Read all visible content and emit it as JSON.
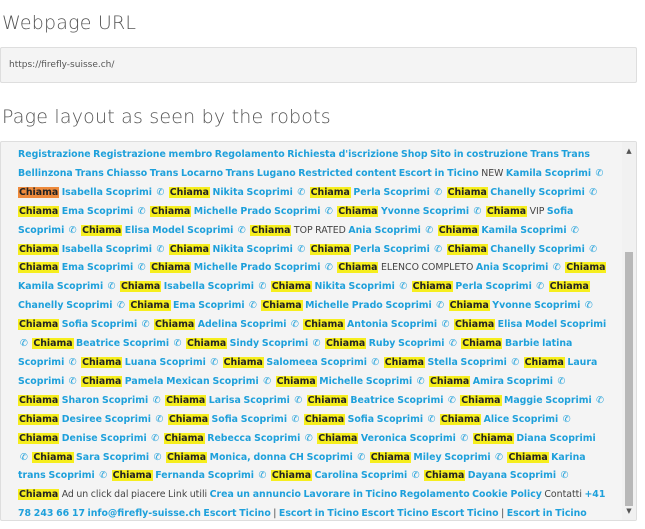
{
  "headings": {
    "url": "Webpage URL",
    "layout": "Page layout as seen by the robots"
  },
  "url_value": "https://firefly-suisse.ch/",
  "icons": {
    "phone": "phone-icon",
    "scroll_up": "scroll-up-arrow-icon",
    "scroll_down": "scroll-down-arrow-icon"
  },
  "colors": {
    "link": "#1ea0db",
    "highlight": "#f6ee1e",
    "highlight_current": "#ee8a3c"
  },
  "tokens": [
    {
      "t": "link",
      "v": "Registrazione"
    },
    {
      "t": "link",
      "v": "Registrazione membro"
    },
    {
      "t": "link",
      "v": "Regolamento"
    },
    {
      "t": "link",
      "v": "Richiesta d'iscrizione"
    },
    {
      "t": "link",
      "v": "Shop"
    },
    {
      "t": "link",
      "v": "Sito in costruzione"
    },
    {
      "t": "link",
      "v": "Trans"
    },
    {
      "t": "link",
      "v": "Trans Bellinzona"
    },
    {
      "t": "link",
      "v": "Trans Chiasso"
    },
    {
      "t": "link",
      "v": "Trans Locarno"
    },
    {
      "t": "link",
      "v": "Trans Lugano"
    },
    {
      "t": "link",
      "v": "Restricted content"
    },
    {
      "t": "link",
      "v": "Escort in Ticino"
    },
    {
      "t": "plain",
      "v": "NEW"
    },
    {
      "t": "link",
      "v": "Kamila Scoprimi"
    },
    {
      "t": "phone"
    },
    {
      "t": "mark",
      "v": "Chiama",
      "cur": true
    },
    {
      "t": "link",
      "v": "Isabella Scoprimi"
    },
    {
      "t": "phone"
    },
    {
      "t": "mark",
      "v": "Chiama"
    },
    {
      "t": "link",
      "v": "Nikita Scoprimi"
    },
    {
      "t": "phone"
    },
    {
      "t": "mark",
      "v": "Chiama"
    },
    {
      "t": "link",
      "v": "Perla Scoprimi"
    },
    {
      "t": "phone"
    },
    {
      "t": "mark",
      "v": "Chiama"
    },
    {
      "t": "link",
      "v": "Chanelly Scoprimi"
    },
    {
      "t": "phone"
    },
    {
      "t": "mark",
      "v": "Chiama"
    },
    {
      "t": "link",
      "v": "Ema Scoprimi"
    },
    {
      "t": "phone"
    },
    {
      "t": "mark",
      "v": "Chiama"
    },
    {
      "t": "link",
      "v": "Michelle Prado Scoprimi"
    },
    {
      "t": "phone"
    },
    {
      "t": "mark",
      "v": "Chiama"
    },
    {
      "t": "link",
      "v": "Yvonne Scoprimi"
    },
    {
      "t": "phone"
    },
    {
      "t": "mark",
      "v": "Chiama"
    },
    {
      "t": "plain",
      "v": "VIP"
    },
    {
      "t": "link",
      "v": "Sofia Scoprimi"
    },
    {
      "t": "phone"
    },
    {
      "t": "mark",
      "v": "Chiama"
    },
    {
      "t": "link",
      "v": "Elisa Model Scoprimi"
    },
    {
      "t": "phone"
    },
    {
      "t": "mark",
      "v": "Chiama"
    },
    {
      "t": "plain",
      "v": "TOP RATED"
    },
    {
      "t": "link",
      "v": "Ania Scoprimi"
    },
    {
      "t": "phone"
    },
    {
      "t": "mark",
      "v": "Chiama"
    },
    {
      "t": "link",
      "v": "Kamila Scoprimi"
    },
    {
      "t": "phone"
    },
    {
      "t": "mark",
      "v": "Chiama"
    },
    {
      "t": "link",
      "v": "Isabella Scoprimi"
    },
    {
      "t": "phone"
    },
    {
      "t": "mark",
      "v": "Chiama"
    },
    {
      "t": "link",
      "v": "Nikita Scoprimi"
    },
    {
      "t": "phone"
    },
    {
      "t": "mark",
      "v": "Chiama"
    },
    {
      "t": "link",
      "v": "Perla Scoprimi"
    },
    {
      "t": "phone"
    },
    {
      "t": "mark",
      "v": "Chiama"
    },
    {
      "t": "link",
      "v": "Chanelly Scoprimi"
    },
    {
      "t": "phone"
    },
    {
      "t": "mark",
      "v": "Chiama"
    },
    {
      "t": "link",
      "v": "Ema Scoprimi"
    },
    {
      "t": "phone"
    },
    {
      "t": "mark",
      "v": "Chiama"
    },
    {
      "t": "link",
      "v": "Michelle Prado Scoprimi"
    },
    {
      "t": "phone"
    },
    {
      "t": "mark",
      "v": "Chiama"
    },
    {
      "t": "plain",
      "v": "ELENCO COMPLETO"
    },
    {
      "t": "link",
      "v": "Ania Scoprimi"
    },
    {
      "t": "phone"
    },
    {
      "t": "mark",
      "v": "Chiama"
    },
    {
      "t": "link",
      "v": "Kamila Scoprimi"
    },
    {
      "t": "phone"
    },
    {
      "t": "mark",
      "v": "Chiama"
    },
    {
      "t": "link",
      "v": "Isabella Scoprimi"
    },
    {
      "t": "phone"
    },
    {
      "t": "mark",
      "v": "Chiama"
    },
    {
      "t": "link",
      "v": "Nikita Scoprimi"
    },
    {
      "t": "phone"
    },
    {
      "t": "mark",
      "v": "Chiama"
    },
    {
      "t": "link",
      "v": "Perla Scoprimi"
    },
    {
      "t": "phone"
    },
    {
      "t": "mark",
      "v": "Chiama"
    },
    {
      "t": "link",
      "v": "Chanelly Scoprimi"
    },
    {
      "t": "phone"
    },
    {
      "t": "mark",
      "v": "Chiama"
    },
    {
      "t": "link",
      "v": "Ema Scoprimi"
    },
    {
      "t": "phone"
    },
    {
      "t": "mark",
      "v": "Chiama"
    },
    {
      "t": "link",
      "v": "Michelle Prado Scoprimi"
    },
    {
      "t": "phone"
    },
    {
      "t": "mark",
      "v": "Chiama"
    },
    {
      "t": "link",
      "v": "Yvonne Scoprimi"
    },
    {
      "t": "phone"
    },
    {
      "t": "mark",
      "v": "Chiama"
    },
    {
      "t": "link",
      "v": "Sofia Scoprimi"
    },
    {
      "t": "phone"
    },
    {
      "t": "mark",
      "v": "Chiama"
    },
    {
      "t": "link",
      "v": "Adelina Scoprimi"
    },
    {
      "t": "phone"
    },
    {
      "t": "mark",
      "v": "Chiama"
    },
    {
      "t": "link",
      "v": "Antonia Scoprimi"
    },
    {
      "t": "phone"
    },
    {
      "t": "mark",
      "v": "Chiama"
    },
    {
      "t": "link",
      "v": "Elisa Model Scoprimi"
    },
    {
      "t": "phone"
    },
    {
      "t": "mark",
      "v": "Chiama"
    },
    {
      "t": "link",
      "v": "Beatrice Scoprimi"
    },
    {
      "t": "phone"
    },
    {
      "t": "mark",
      "v": "Chiama"
    },
    {
      "t": "link",
      "v": "Sindy Scoprimi"
    },
    {
      "t": "phone"
    },
    {
      "t": "mark",
      "v": "Chiama"
    },
    {
      "t": "link",
      "v": "Ruby Scoprimi"
    },
    {
      "t": "phone"
    },
    {
      "t": "mark",
      "v": "Chiama"
    },
    {
      "t": "link",
      "v": "Barbie latina Scoprimi"
    },
    {
      "t": "phone"
    },
    {
      "t": "mark",
      "v": "Chiama"
    },
    {
      "t": "link",
      "v": "Luana Scoprimi"
    },
    {
      "t": "phone"
    },
    {
      "t": "mark",
      "v": "Chiama"
    },
    {
      "t": "link",
      "v": "Salomeea Scoprimi"
    },
    {
      "t": "phone"
    },
    {
      "t": "mark",
      "v": "Chiama"
    },
    {
      "t": "link",
      "v": "Stella Scoprimi"
    },
    {
      "t": "phone"
    },
    {
      "t": "mark",
      "v": "Chiama"
    },
    {
      "t": "link",
      "v": "Laura Scoprimi"
    },
    {
      "t": "phone"
    },
    {
      "t": "mark",
      "v": "Chiama"
    },
    {
      "t": "link",
      "v": "Pamela Mexican Scoprimi"
    },
    {
      "t": "phone"
    },
    {
      "t": "mark",
      "v": "Chiama"
    },
    {
      "t": "link",
      "v": "Michelle Scoprimi"
    },
    {
      "t": "phone"
    },
    {
      "t": "mark",
      "v": "Chiama"
    },
    {
      "t": "link",
      "v": "Amira Scoprimi"
    },
    {
      "t": "phone"
    },
    {
      "t": "mark",
      "v": "Chiama"
    },
    {
      "t": "link",
      "v": "Sharon Scoprimi"
    },
    {
      "t": "phone"
    },
    {
      "t": "mark",
      "v": "Chiama"
    },
    {
      "t": "link",
      "v": "Larisa Scoprimi"
    },
    {
      "t": "phone"
    },
    {
      "t": "mark",
      "v": "Chiama"
    },
    {
      "t": "link",
      "v": "Beatrice Scoprimi"
    },
    {
      "t": "phone"
    },
    {
      "t": "mark",
      "v": "Chiama"
    },
    {
      "t": "link",
      "v": "Maggie Scoprimi"
    },
    {
      "t": "phone"
    },
    {
      "t": "mark",
      "v": "Chiama"
    },
    {
      "t": "link",
      "v": "Desiree Scoprimi"
    },
    {
      "t": "phone"
    },
    {
      "t": "mark",
      "v": "Chiama"
    },
    {
      "t": "link",
      "v": "Sofia Scoprimi"
    },
    {
      "t": "phone"
    },
    {
      "t": "mark",
      "v": "Chiama"
    },
    {
      "t": "link",
      "v": "Sofia Scoprimi"
    },
    {
      "t": "phone"
    },
    {
      "t": "mark",
      "v": "Chiama"
    },
    {
      "t": "link",
      "v": "Alice Scoprimi"
    },
    {
      "t": "phone"
    },
    {
      "t": "mark",
      "v": "Chiama"
    },
    {
      "t": "link",
      "v": "Denise Scoprimi"
    },
    {
      "t": "phone"
    },
    {
      "t": "mark",
      "v": "Chiama"
    },
    {
      "t": "link",
      "v": "Rebecca Scoprimi"
    },
    {
      "t": "phone"
    },
    {
      "t": "mark",
      "v": "Chiama"
    },
    {
      "t": "link",
      "v": "Veronica Scoprimi"
    },
    {
      "t": "phone"
    },
    {
      "t": "mark",
      "v": "Chiama"
    },
    {
      "t": "link",
      "v": "Diana Scoprimi"
    },
    {
      "t": "phone"
    },
    {
      "t": "mark",
      "v": "Chiama"
    },
    {
      "t": "link",
      "v": "Sara Scoprimi"
    },
    {
      "t": "phone"
    },
    {
      "t": "mark",
      "v": "Chiama"
    },
    {
      "t": "link",
      "v": "Monica, donna CH Scoprimi"
    },
    {
      "t": "phone"
    },
    {
      "t": "mark",
      "v": "Chiama"
    },
    {
      "t": "link",
      "v": "Miley Scoprimi"
    },
    {
      "t": "phone"
    },
    {
      "t": "mark",
      "v": "Chiama"
    },
    {
      "t": "link",
      "v": "Karina trans Scoprimi"
    },
    {
      "t": "phone"
    },
    {
      "t": "mark",
      "v": "Chiama"
    },
    {
      "t": "link",
      "v": "Fernanda Scoprimi"
    },
    {
      "t": "phone"
    },
    {
      "t": "mark",
      "v": "Chiama"
    },
    {
      "t": "link",
      "v": "Carolina Scoprimi"
    },
    {
      "t": "phone"
    },
    {
      "t": "mark",
      "v": "Chiama"
    },
    {
      "t": "link",
      "v": "Dayana Scoprimi"
    },
    {
      "t": "phone"
    },
    {
      "t": "mark",
      "v": "Chiama"
    },
    {
      "t": "plain",
      "v": "Ad un click dal piacere Link utili"
    },
    {
      "t": "link",
      "v": "Crea un annuncio"
    },
    {
      "t": "link",
      "v": "Lavorare in Ticino"
    },
    {
      "t": "link",
      "v": "Regolamento"
    },
    {
      "t": "link",
      "v": "Cookie Policy"
    },
    {
      "t": "plain",
      "v": "Contatti"
    },
    {
      "t": "link",
      "v": "+41 78 243 66 17"
    },
    {
      "t": "link",
      "v": "info@firefly-suisse.ch"
    },
    {
      "t": "link",
      "v": "Escort Ticino"
    },
    {
      "t": "plain",
      "v": "|"
    },
    {
      "t": "link",
      "v": "Escort in Ticino"
    },
    {
      "t": "link",
      "v": "Escort Ticino"
    },
    {
      "t": "link",
      "v": "Escort Ticino"
    },
    {
      "t": "plain",
      "v": "|"
    },
    {
      "t": "link",
      "v": "Escort in Ticino"
    }
  ]
}
